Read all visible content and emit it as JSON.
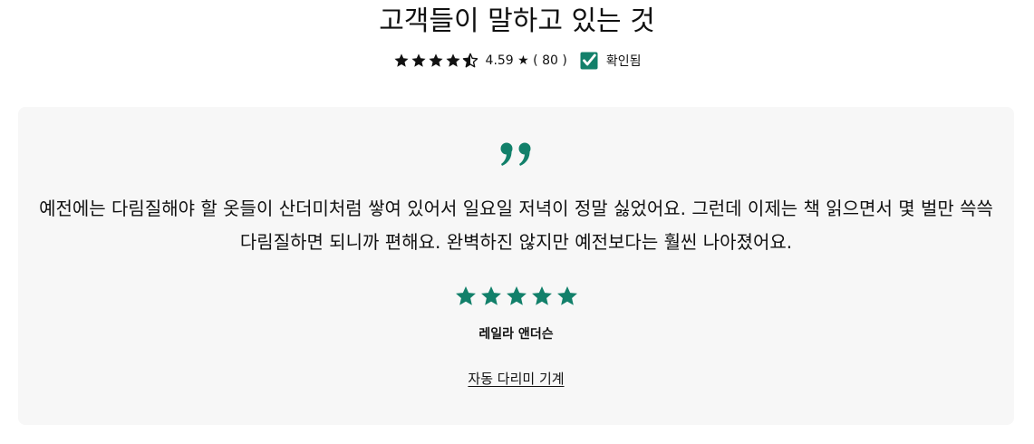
{
  "header": {
    "title": "고객들이 말하고 있는 것",
    "rating_value": "4.59",
    "rating_star_glyph": "★",
    "review_count_text": "( 80 )",
    "verified_label": "확인됨",
    "summary_stars": 4.5,
    "summary_star_color": "#111111"
  },
  "review": {
    "quote_icon": "quote-icon",
    "text": "예전에는 다림질해야 할 옷들이 산더미처럼 쌓여 있어서 일요일 저녁이 정말 싫었어요. 그런데 이제는 책 읽으면서 몇 벌만 쓱쓱 다림질하면 되니까 편해요. 완벽하진 않지만 예전보다는 훨씬 나아졌어요.",
    "stars": 5,
    "reviewer_name": "레일라 앤더슨",
    "product_link": "자동 다리미 기계"
  },
  "colors": {
    "accent": "#12806a",
    "card_background": "#f7f7f7",
    "text": "#111111"
  }
}
